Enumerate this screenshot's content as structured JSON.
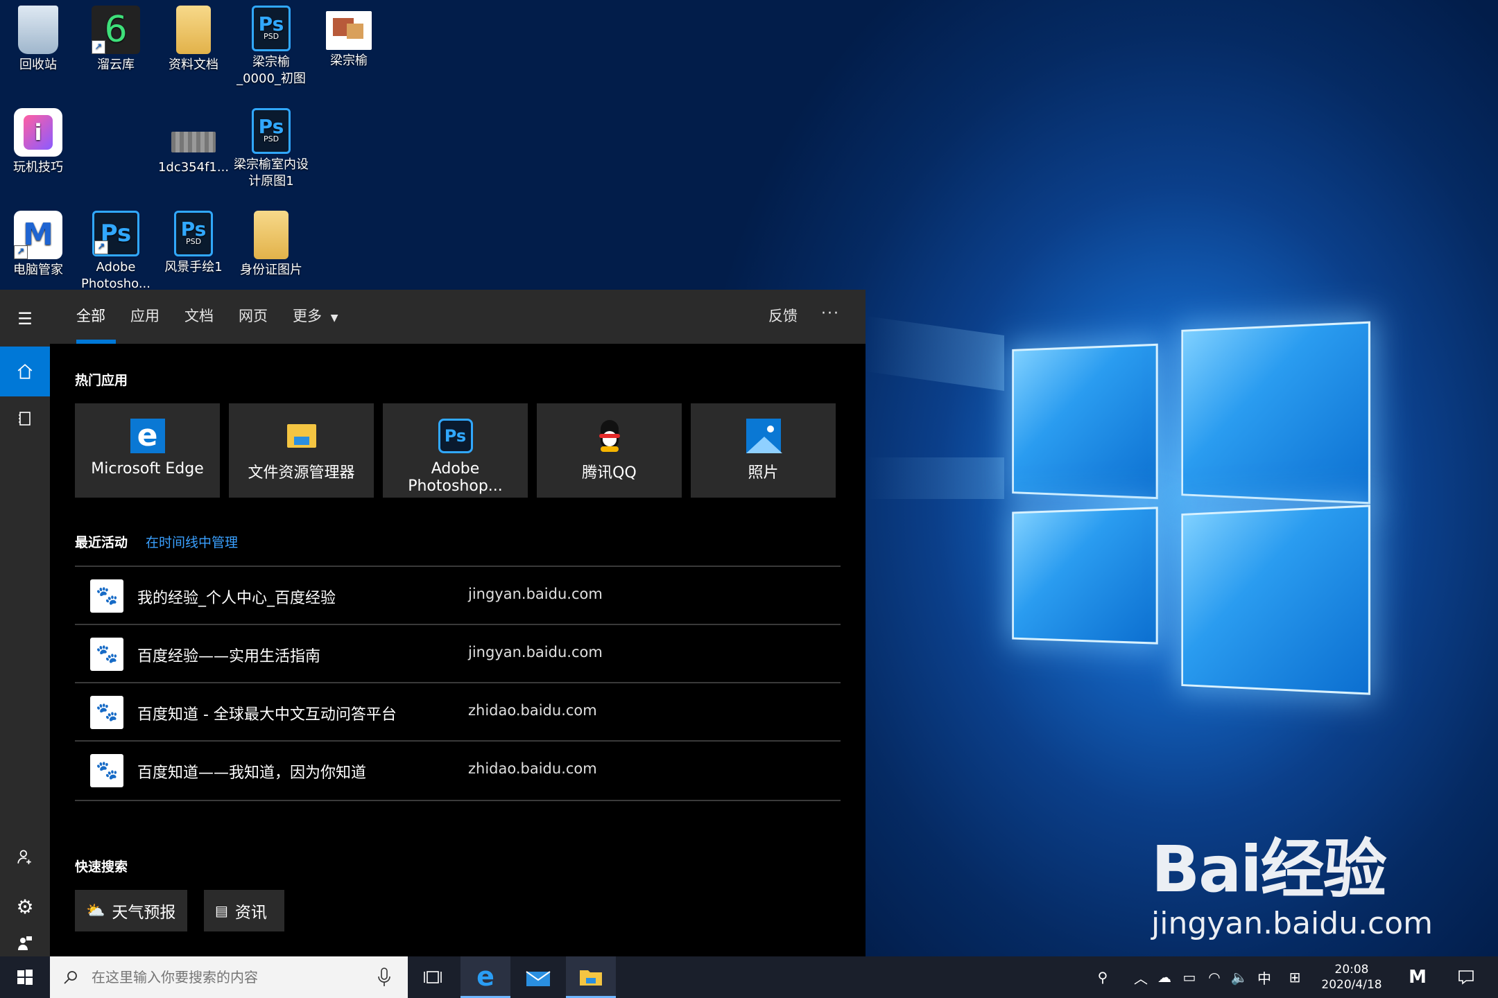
{
  "colors": {
    "accent": "#0078d7",
    "panel_bg": "#000000",
    "tile_bg": "#2b2b2b",
    "taskbar_bg": "#1a1f2b",
    "link": "#3aa0ff"
  },
  "desktop": {
    "icons": [
      {
        "label": "回收站",
        "icon": "recycle-bin-icon"
      },
      {
        "label": "溜云库",
        "icon": "liuyunku-app-icon"
      },
      {
        "label": "资料文档",
        "icon": "folder-icon"
      },
      {
        "label": "梁宗榆_0000_初图",
        "line1": "梁宗榆",
        "line2": "_0000_初图",
        "icon": "psd-file-icon"
      },
      {
        "label": "梁宗榆",
        "icon": "image-file-icon"
      },
      {
        "label": "玩机技巧",
        "icon": "tips-app-icon"
      },
      {
        "label": "1dc354f1...",
        "icon": "image-thumbnail-icon"
      },
      {
        "label": "梁宗榆室内设计原图1",
        "line1": "梁宗榆室内设",
        "line2": "计原图1",
        "icon": "psd-file-icon"
      },
      {
        "label": "电脑管家",
        "icon": "pc-manager-icon"
      },
      {
        "label": "Adobe Photosho...",
        "line1": "Adobe",
        "line2": "Photosho...",
        "icon": "photoshop-app-icon"
      },
      {
        "label": "风景手绘1",
        "icon": "psd-file-icon"
      },
      {
        "label": "身份证图片",
        "icon": "folder-icon"
      }
    ]
  },
  "search_panel": {
    "tabs": [
      "全部",
      "应用",
      "文档",
      "网页",
      "更多"
    ],
    "active_tab": "全部",
    "feedback_label": "反馈",
    "more_options_label": "···",
    "popular_title": "热门应用",
    "popular_apps": [
      {
        "label": "Microsoft Edge",
        "icon": "edge-icon"
      },
      {
        "label": "文件资源管理器",
        "icon": "file-explorer-icon"
      },
      {
        "label": "Adobe Photoshop...",
        "icon": "photoshop-icon"
      },
      {
        "label": "腾讯QQ",
        "icon": "qq-icon"
      },
      {
        "label": "照片",
        "icon": "photos-icon"
      }
    ],
    "recent_title": "最近活动",
    "recent_manage_link": "在时间线中管理",
    "recent_items": [
      {
        "title": "我的经验_个人中心_百度经验",
        "domain": "jingyan.baidu.com"
      },
      {
        "title": "百度经验——实用生活指南",
        "domain": "jingyan.baidu.com"
      },
      {
        "title": "百度知道 - 全球最大中文互动问答平台",
        "domain": "zhidao.baidu.com"
      },
      {
        "title": "百度知道——我知道，因为你知道",
        "domain": "zhidao.baidu.com"
      }
    ],
    "quick_title": "快速搜索",
    "quick_items": [
      {
        "label": "天气预报",
        "icon": "weather-icon"
      },
      {
        "label": "资讯",
        "icon": "news-icon"
      }
    ]
  },
  "taskbar": {
    "search_placeholder": "在这里输入你要搜索的内容",
    "ime_label": "中",
    "time": "20:08",
    "date": "2020/4/18"
  },
  "watermark": {
    "brand": "Bai经验",
    "url": "jingyan.baidu.com"
  }
}
